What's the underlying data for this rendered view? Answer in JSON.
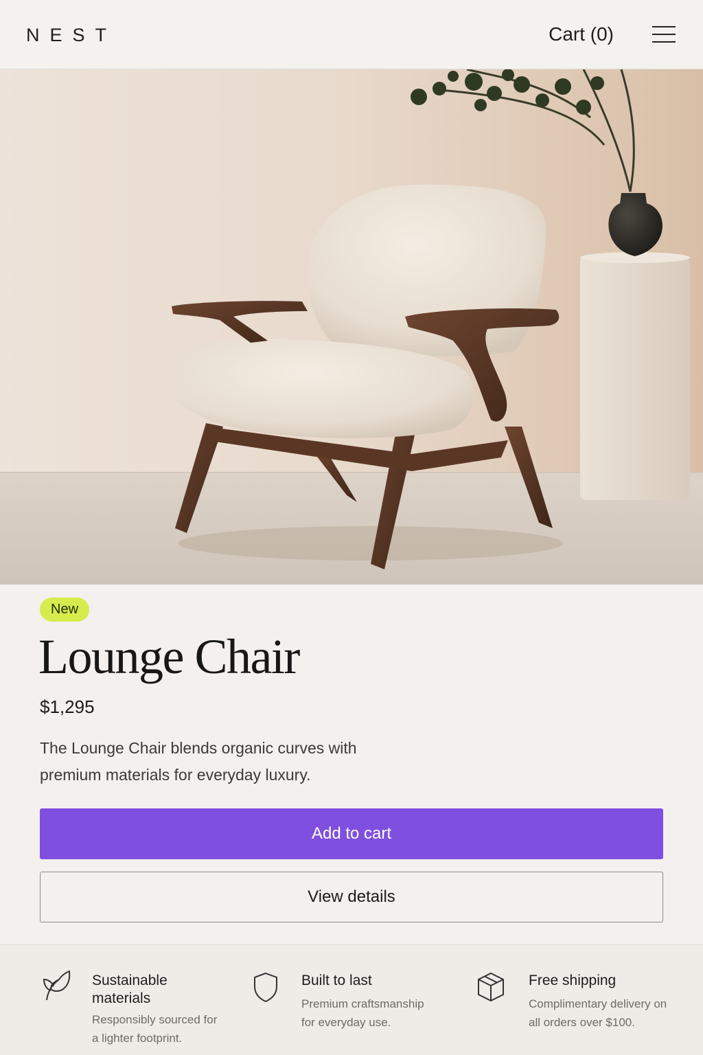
{
  "header": {
    "logo": "NEST",
    "cart_label": "Cart (0)"
  },
  "product": {
    "badge": "New",
    "title": "Lounge Chair",
    "price": "$1,295",
    "description": "The Lounge Chair blends organic curves with premium materials for everyday luxury."
  },
  "actions": {
    "add_to_cart": "Add to cart",
    "view_details": "View details"
  },
  "features": [
    {
      "icon": "leaf-icon",
      "title": "Sustainable materials",
      "desc": "Responsibly sourced for a lighter footprint."
    },
    {
      "icon": "shield-icon",
      "title": "Built to last",
      "desc": "Premium craftsmanship for everyday use."
    },
    {
      "icon": "box-icon",
      "title": "Free shipping",
      "desc": "Complimentary delivery on all orders over $100."
    }
  ],
  "colors": {
    "accent": "#7f4fe0",
    "badge": "#d6ec4c",
    "background": "#f3f0ed"
  }
}
